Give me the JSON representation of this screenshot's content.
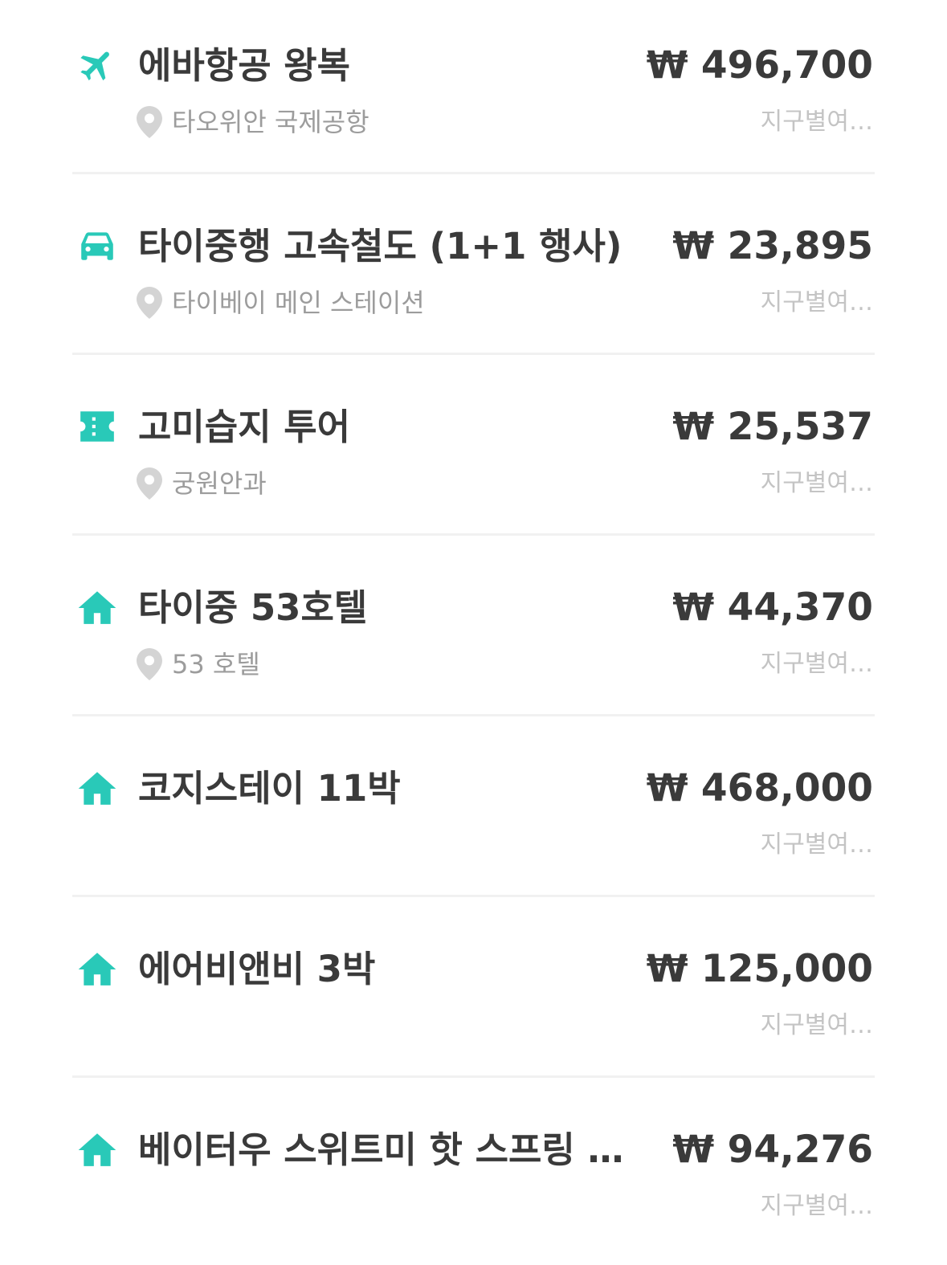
{
  "accent_color": "#29c9b8",
  "items": [
    {
      "icon": "airplane-icon",
      "title": "에바항공 왕복",
      "price": "₩ 496,700",
      "location": "타오위안 국제공항",
      "category": "지구별여…"
    },
    {
      "icon": "car-icon",
      "title": "타이중행 고속철도 (1+1 행사)",
      "price": "₩ 23,895",
      "location": "타이베이 메인 스테이션",
      "category": "지구별여…"
    },
    {
      "icon": "ticket-icon",
      "title": "고미습지 투어",
      "price": "₩ 25,537",
      "location": "궁원안과",
      "category": "지구별여…"
    },
    {
      "icon": "house-icon",
      "title": "타이중 53호텔",
      "price": "₩ 44,370",
      "location": "53 호텔",
      "category": "지구별여…"
    },
    {
      "icon": "house-icon",
      "title": "코지스테이 11박",
      "price": "₩ 468,000",
      "location": "",
      "category": "지구별여…"
    },
    {
      "icon": "house-icon",
      "title": "에어비앤비 3박",
      "price": "₩ 125,000",
      "location": "",
      "category": "지구별여…"
    },
    {
      "icon": "house-icon",
      "title": "베이터우 스위트미 핫 스프링 리…",
      "price": "₩ 94,276",
      "location": "",
      "category": "지구별여…"
    }
  ]
}
